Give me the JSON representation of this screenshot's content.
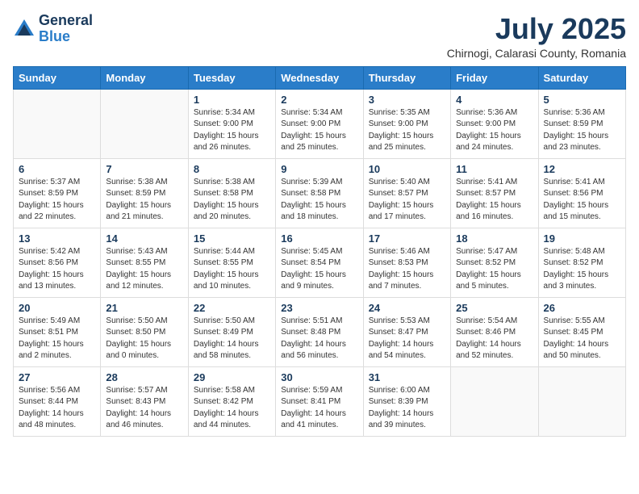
{
  "logo": {
    "general": "General",
    "blue": "Blue"
  },
  "title": {
    "month": "July 2025",
    "location": "Chirnogi, Calarasi County, Romania"
  },
  "days_of_week": [
    "Sunday",
    "Monday",
    "Tuesday",
    "Wednesday",
    "Thursday",
    "Friday",
    "Saturday"
  ],
  "weeks": [
    [
      {
        "day": "",
        "info": ""
      },
      {
        "day": "",
        "info": ""
      },
      {
        "day": "1",
        "info": "Sunrise: 5:34 AM\nSunset: 9:00 PM\nDaylight: 15 hours\nand 26 minutes."
      },
      {
        "day": "2",
        "info": "Sunrise: 5:34 AM\nSunset: 9:00 PM\nDaylight: 15 hours\nand 25 minutes."
      },
      {
        "day": "3",
        "info": "Sunrise: 5:35 AM\nSunset: 9:00 PM\nDaylight: 15 hours\nand 25 minutes."
      },
      {
        "day": "4",
        "info": "Sunrise: 5:36 AM\nSunset: 9:00 PM\nDaylight: 15 hours\nand 24 minutes."
      },
      {
        "day": "5",
        "info": "Sunrise: 5:36 AM\nSunset: 8:59 PM\nDaylight: 15 hours\nand 23 minutes."
      }
    ],
    [
      {
        "day": "6",
        "info": "Sunrise: 5:37 AM\nSunset: 8:59 PM\nDaylight: 15 hours\nand 22 minutes."
      },
      {
        "day": "7",
        "info": "Sunrise: 5:38 AM\nSunset: 8:59 PM\nDaylight: 15 hours\nand 21 minutes."
      },
      {
        "day": "8",
        "info": "Sunrise: 5:38 AM\nSunset: 8:58 PM\nDaylight: 15 hours\nand 20 minutes."
      },
      {
        "day": "9",
        "info": "Sunrise: 5:39 AM\nSunset: 8:58 PM\nDaylight: 15 hours\nand 18 minutes."
      },
      {
        "day": "10",
        "info": "Sunrise: 5:40 AM\nSunset: 8:57 PM\nDaylight: 15 hours\nand 17 minutes."
      },
      {
        "day": "11",
        "info": "Sunrise: 5:41 AM\nSunset: 8:57 PM\nDaylight: 15 hours\nand 16 minutes."
      },
      {
        "day": "12",
        "info": "Sunrise: 5:41 AM\nSunset: 8:56 PM\nDaylight: 15 hours\nand 15 minutes."
      }
    ],
    [
      {
        "day": "13",
        "info": "Sunrise: 5:42 AM\nSunset: 8:56 PM\nDaylight: 15 hours\nand 13 minutes."
      },
      {
        "day": "14",
        "info": "Sunrise: 5:43 AM\nSunset: 8:55 PM\nDaylight: 15 hours\nand 12 minutes."
      },
      {
        "day": "15",
        "info": "Sunrise: 5:44 AM\nSunset: 8:55 PM\nDaylight: 15 hours\nand 10 minutes."
      },
      {
        "day": "16",
        "info": "Sunrise: 5:45 AM\nSunset: 8:54 PM\nDaylight: 15 hours\nand 9 minutes."
      },
      {
        "day": "17",
        "info": "Sunrise: 5:46 AM\nSunset: 8:53 PM\nDaylight: 15 hours\nand 7 minutes."
      },
      {
        "day": "18",
        "info": "Sunrise: 5:47 AM\nSunset: 8:52 PM\nDaylight: 15 hours\nand 5 minutes."
      },
      {
        "day": "19",
        "info": "Sunrise: 5:48 AM\nSunset: 8:52 PM\nDaylight: 15 hours\nand 3 minutes."
      }
    ],
    [
      {
        "day": "20",
        "info": "Sunrise: 5:49 AM\nSunset: 8:51 PM\nDaylight: 15 hours\nand 2 minutes."
      },
      {
        "day": "21",
        "info": "Sunrise: 5:50 AM\nSunset: 8:50 PM\nDaylight: 15 hours\nand 0 minutes."
      },
      {
        "day": "22",
        "info": "Sunrise: 5:50 AM\nSunset: 8:49 PM\nDaylight: 14 hours\nand 58 minutes."
      },
      {
        "day": "23",
        "info": "Sunrise: 5:51 AM\nSunset: 8:48 PM\nDaylight: 14 hours\nand 56 minutes."
      },
      {
        "day": "24",
        "info": "Sunrise: 5:53 AM\nSunset: 8:47 PM\nDaylight: 14 hours\nand 54 minutes."
      },
      {
        "day": "25",
        "info": "Sunrise: 5:54 AM\nSunset: 8:46 PM\nDaylight: 14 hours\nand 52 minutes."
      },
      {
        "day": "26",
        "info": "Sunrise: 5:55 AM\nSunset: 8:45 PM\nDaylight: 14 hours\nand 50 minutes."
      }
    ],
    [
      {
        "day": "27",
        "info": "Sunrise: 5:56 AM\nSunset: 8:44 PM\nDaylight: 14 hours\nand 48 minutes."
      },
      {
        "day": "28",
        "info": "Sunrise: 5:57 AM\nSunset: 8:43 PM\nDaylight: 14 hours\nand 46 minutes."
      },
      {
        "day": "29",
        "info": "Sunrise: 5:58 AM\nSunset: 8:42 PM\nDaylight: 14 hours\nand 44 minutes."
      },
      {
        "day": "30",
        "info": "Sunrise: 5:59 AM\nSunset: 8:41 PM\nDaylight: 14 hours\nand 41 minutes."
      },
      {
        "day": "31",
        "info": "Sunrise: 6:00 AM\nSunset: 8:39 PM\nDaylight: 14 hours\nand 39 minutes."
      },
      {
        "day": "",
        "info": ""
      },
      {
        "day": "",
        "info": ""
      }
    ]
  ]
}
